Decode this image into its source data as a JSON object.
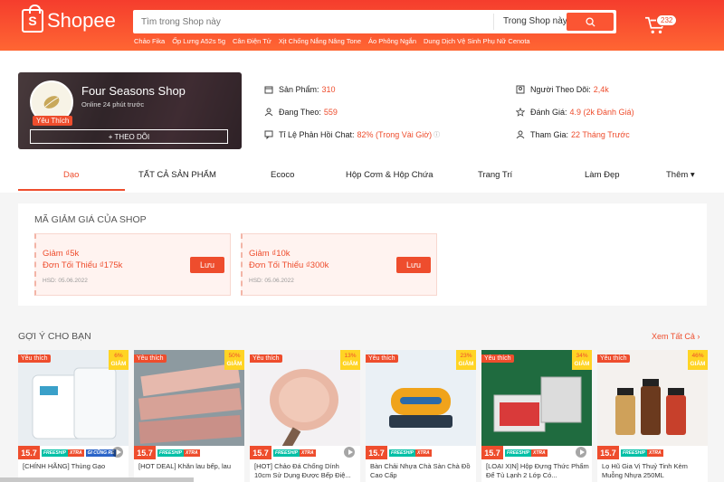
{
  "header": {
    "logo_text": "Shopee",
    "search_placeholder": "Tìm trong Shop này",
    "search_scope": "Trong Shop này",
    "cart_count": "232",
    "suggestions": [
      "Chảo Fika",
      "Ốp Lưng A52s 5g",
      "Cân Điện Tử",
      "Xịt Chống Nắng Nâng Tone",
      "Áo Phông Ngắn",
      "Dung Dịch Vệ Sinh Phụ Nữ Cenota"
    ]
  },
  "shop": {
    "name": "Four Seasons Shop",
    "online": "Online 24 phút trước",
    "badge": "Yêu Thích",
    "follow_label": "+ THEO DÕI",
    "stats": {
      "products_label": "Sản Phẩm:",
      "products_value": "310",
      "following_label": "Đang Theo:",
      "following_value": "559",
      "chat_label": "Tỉ Lệ Phản Hồi Chat:",
      "chat_value": "82% (Trong Vài Giờ)",
      "followers_label": "Người Theo Dõi:",
      "followers_value": "2,4k",
      "rating_label": "Đánh Giá:",
      "rating_value": "4.9 (2k Đánh Giá)",
      "joined_label": "Tham Gia:",
      "joined_value": "22 Tháng Trước"
    }
  },
  "tabs": [
    {
      "label": "Dạo",
      "active": true
    },
    {
      "label": "TẤT CẢ SẢN PHẨM"
    },
    {
      "label": "Ecoco"
    },
    {
      "label": "Hộp Cơm & Hộp Chứa"
    },
    {
      "label": "Trang Trí"
    },
    {
      "label": "Làm Đẹp"
    },
    {
      "label": "Thêm ▾"
    }
  ],
  "vouchers": {
    "title": "MÃ GIẢM GIÁ CỦA SHOP",
    "items": [
      {
        "discount": "Giảm ₫5k",
        "min": "Đơn Tối Thiểu ₫175k",
        "expiry": "HSD: 05.06.2022",
        "button": "Lưu"
      },
      {
        "discount": "Giảm ₫10k",
        "min": "Đơn Tối Thiểu ₫300k",
        "expiry": "HSD: 05.06.2022",
        "button": "Lưu"
      }
    ]
  },
  "recommend": {
    "title": "GỢI Ý CHO BẠN",
    "see_all": "Xem Tất Cả",
    "fav_label": "Yêu thích",
    "date_label": "15.7",
    "freeship_label": "FREESHIP",
    "xtra_label": "XTRA",
    "discount_word": "GIẢM",
    "products": [
      {
        "discount": "6%",
        "name": "[CHÍNH HÃNG] Thùng Gạo",
        "color": "#e9eef2",
        "sub": "GI CŨNG RẺ",
        "video": true
      },
      {
        "discount": "50%",
        "name": "[HOT DEAL] Khăn lau bếp, lau",
        "color": "#c9a8a0"
      },
      {
        "discount": "13%",
        "name": "[HOT] Chảo Đá Chống Dính 10cm Sử Dụng Được Bếp Điệ...",
        "color": "#f3f1f3",
        "video": true
      },
      {
        "discount": "23%",
        "name": "Bàn Chải Nhựa Chà Sàn Chà Đồ Cao Cấp",
        "color": "#eaf0f5"
      },
      {
        "discount": "34%",
        "name": "[LOẠI XỊN] Hộp Đựng Thức Phẩm Để Tủ Lạnh 2 Lớp Có...",
        "color": "#1f6b3f",
        "video": true
      },
      {
        "discount": "46%",
        "name": "Lọ Hũ Gia Vị Thuỷ Tinh Kèm Muỗng Nhựa 250ML",
        "color": "#f4f1ee"
      }
    ]
  }
}
